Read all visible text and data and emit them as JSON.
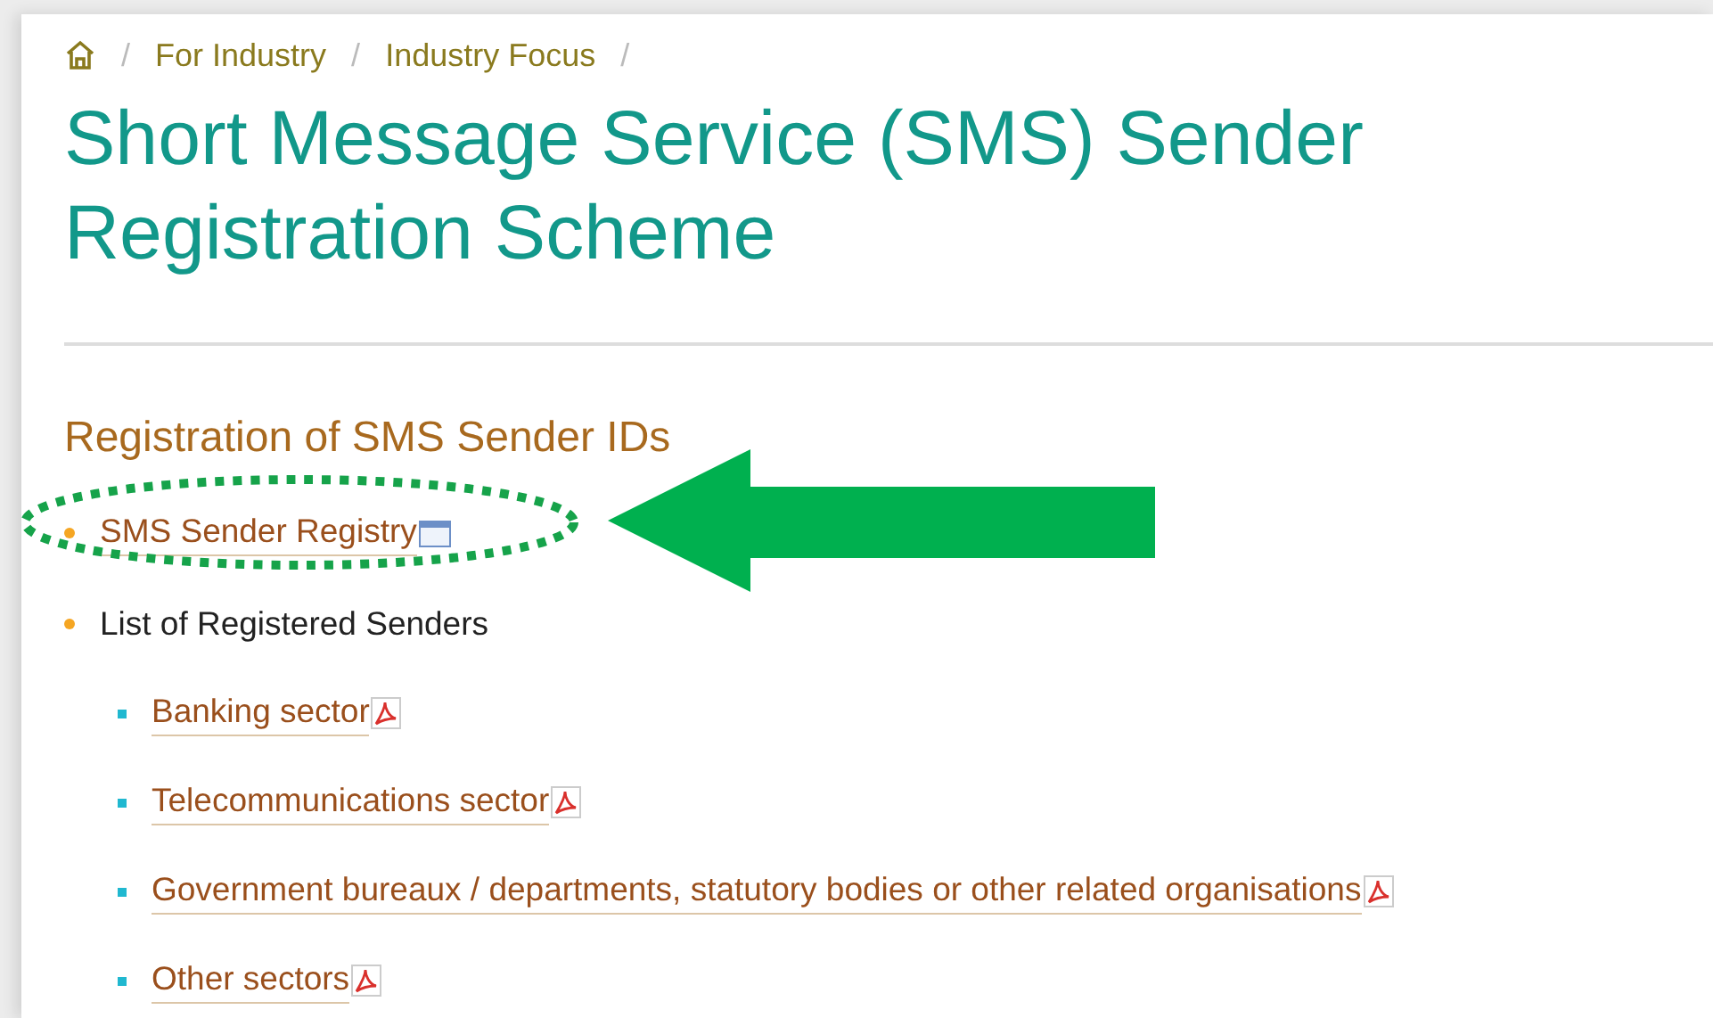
{
  "breadcrumb": {
    "items": [
      {
        "separator": "/",
        "label": "For Industry"
      },
      {
        "separator": "/",
        "label": "Industry Focus"
      }
    ],
    "trailing_separator": "/"
  },
  "title": "Short Message Service (SMS) Sender Registration Scheme",
  "section": {
    "heading": "Registration of SMS Sender IDs",
    "items": [
      {
        "label": "SMS Sender Registry",
        "kind": "weblink"
      },
      {
        "label": "List of Registered Senders",
        "kind": "text",
        "children": [
          {
            "label": "Banking sector",
            "kind": "pdflink"
          },
          {
            "label": "Telecommunications sector",
            "kind": "pdflink"
          },
          {
            "label": "Government bureaux / departments, statutory bodies or other related organisations",
            "kind": "pdflink"
          },
          {
            "label": "Other sectors",
            "kind": "pdflink"
          }
        ]
      }
    ]
  }
}
